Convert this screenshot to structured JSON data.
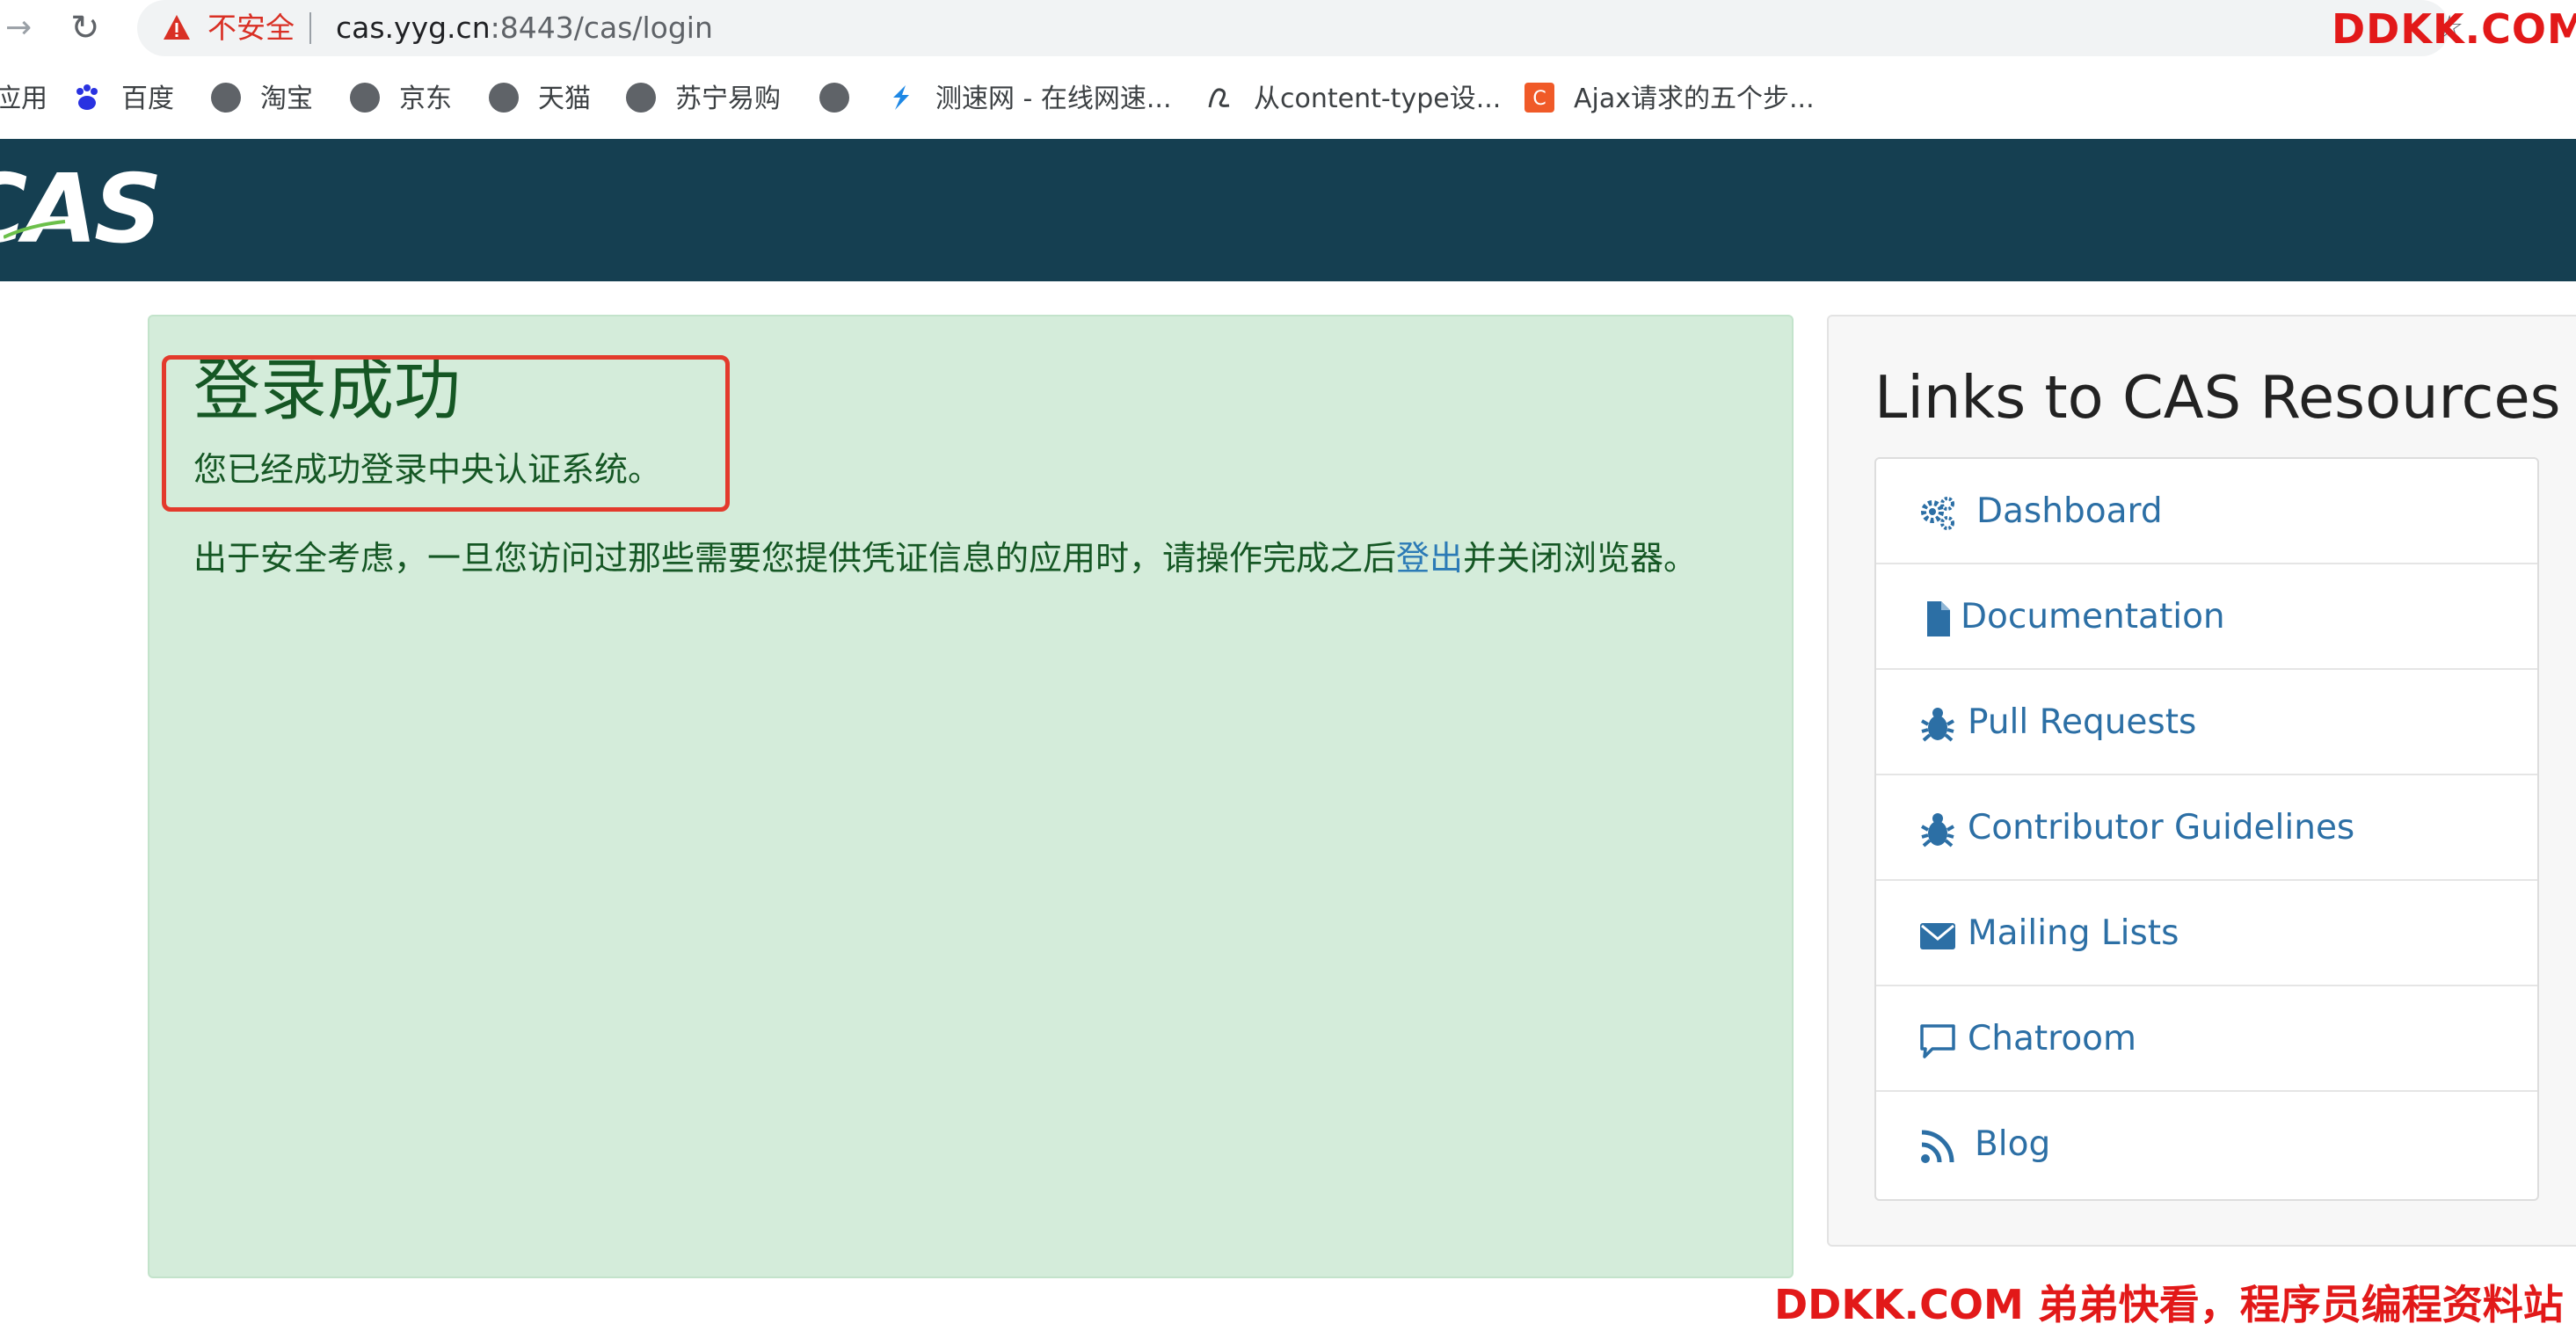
{
  "browser": {
    "insecure_label": "不安全",
    "url_host": "cas.yyg.cn",
    "url_path": ":8443/cas/login"
  },
  "bookmarks": [
    {
      "label": "应用",
      "icon": "apps-icon"
    },
    {
      "label": "百度",
      "icon": "baidu-paw-icon"
    },
    {
      "label": "淘宝",
      "icon": "globe-icon"
    },
    {
      "label": "京东",
      "icon": "globe-icon"
    },
    {
      "label": "天猫",
      "icon": "globe-icon"
    },
    {
      "label": "苏宁易购",
      "icon": "globe-icon"
    },
    {
      "label": "",
      "icon": "globe-icon"
    },
    {
      "label": "测速网 - 在线网速...",
      "icon": "speedtest-icon"
    },
    {
      "label": "从content-type设...",
      "icon": "site-icon"
    },
    {
      "label": "Ajax请求的五个步...",
      "icon": "c-icon"
    }
  ],
  "header": {
    "logo_text": "CAS"
  },
  "success": {
    "title": "登录成功",
    "subtitle": "您已经成功登录中央认证系统。",
    "note_before": "出于安全考虑，一旦您访问过那些需要您提供凭证信息的应用时，请操作完成之后",
    "logout_link": "登出",
    "note_after": "并关闭浏览器。"
  },
  "resources": {
    "title": "Links to CAS Resources",
    "items": [
      {
        "label": "Dashboard",
        "icon": "cogs-icon"
      },
      {
        "label": "Documentation",
        "icon": "file-icon"
      },
      {
        "label": "Pull Requests",
        "icon": "bug-icon"
      },
      {
        "label": "Contributor Guidelines",
        "icon": "bug-icon"
      },
      {
        "label": "Mailing Lists",
        "icon": "envelope-icon"
      },
      {
        "label": "Chatroom",
        "icon": "comment-icon"
      },
      {
        "label": "Blog",
        "icon": "rss-icon"
      }
    ]
  },
  "watermarks": {
    "top": "DDKK.COM",
    "bottom": "DDKK.COM 弟弟快看，程序员编程资料站"
  },
  "colors": {
    "header_bg": "#153f51",
    "success_bg": "#d4ecda",
    "success_text": "#155724",
    "link": "#2c6fa5",
    "highlight": "#e33a2c",
    "watermark": "#e21919"
  }
}
